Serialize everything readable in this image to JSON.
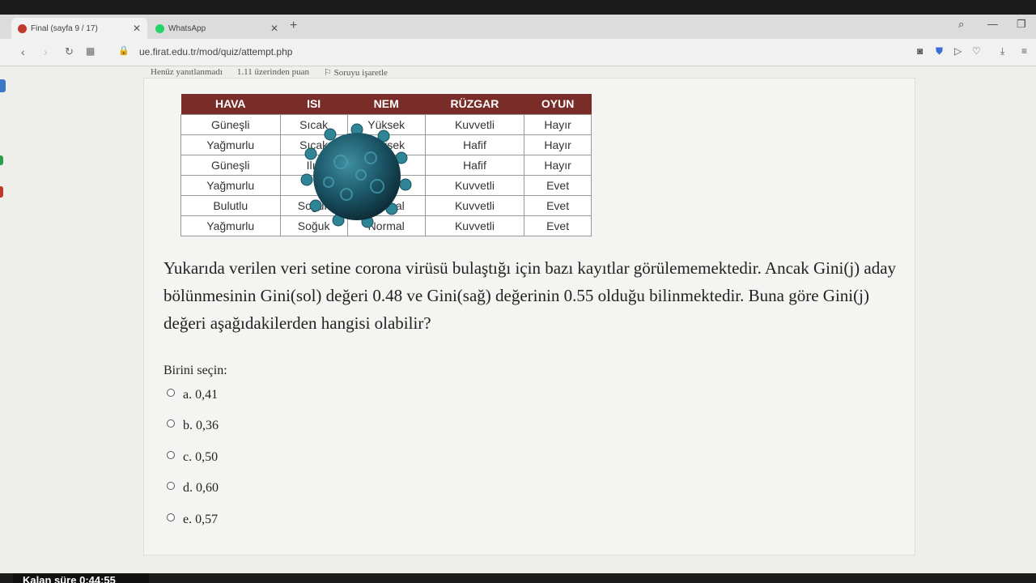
{
  "browser": {
    "tabs": [
      {
        "title": "Final (sayfa 9 / 17)",
        "active": true,
        "favicon_color": "#c0392b"
      },
      {
        "title": "WhatsApp",
        "active": false,
        "favicon_color": "#25d366"
      }
    ],
    "new_tab": "+",
    "url": "ue.firat.edu.tr/mod/quiz/attempt.php"
  },
  "question_info": {
    "status": "Henüz yanıtlanmadı",
    "points": "1.11 üzerinden puan",
    "flag": "Soruyu işaretle"
  },
  "table": {
    "headers": [
      "HAVA",
      "ISI",
      "NEM",
      "RÜZGAR",
      "OYUN"
    ],
    "rows": [
      [
        "Güneşli",
        "Sıcak",
        "Yüksek",
        "Kuvvetli",
        "Hayır"
      ],
      [
        "Yağmurlu",
        "Sıcak",
        "Yüksek",
        "Hafif",
        "Hayır"
      ],
      [
        "Güneşli",
        "Ilık",
        "",
        "Hafif",
        "Hayır"
      ],
      [
        "Yağmurlu",
        "",
        "",
        "Kuvvetli",
        "Evet"
      ],
      [
        "Bulutlu",
        "Soğuk",
        "Normal",
        "Kuvvetli",
        "Evet"
      ],
      [
        "Yağmurlu",
        "Soğuk",
        "Normal",
        "Kuvvetli",
        "Evet"
      ]
    ],
    "header_color": "#7a2d28"
  },
  "question": {
    "text": "Yukarıda verilen veri setine corona virüsü bulaştığı için bazı kayıtlar görülememektedir. Ancak Gini(j) aday bölünmesinin Gini(sol) değeri 0.48 ve Gini(sağ) değerinin 0.55 olduğu bilinmektedir. Buna göre Gini(j) değeri aşağıdakilerden hangisi olabilir?",
    "prompt": "Birini seçin:",
    "options": [
      "a. 0,41",
      "b. 0,36",
      "c. 0,50",
      "d. 0,60",
      "e. 0,57"
    ]
  },
  "timer": "Kalan süre 0:44:55"
}
